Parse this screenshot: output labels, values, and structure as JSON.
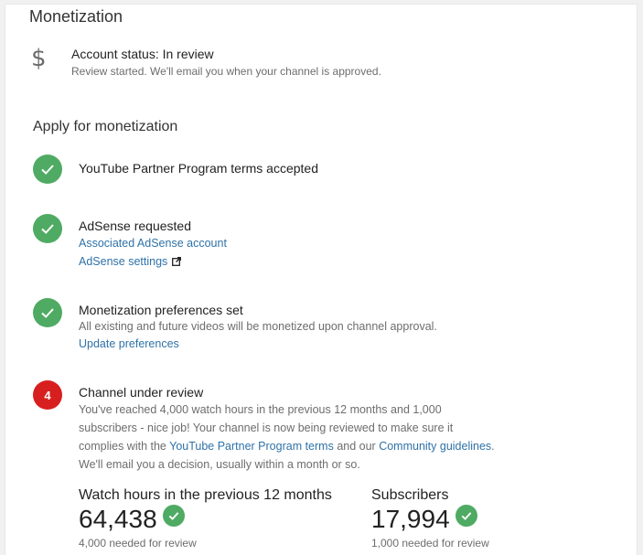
{
  "header": {
    "title": "Monetization"
  },
  "status": {
    "icon": "dollar-icon",
    "symbol": "$",
    "title": "Account status: In review",
    "description": "Review started. We'll email you when your channel is approved."
  },
  "apply": {
    "heading": "Apply for monetization",
    "steps": [
      {
        "title": "YouTube Partner Program terms accepted"
      },
      {
        "title": "AdSense requested",
        "links": [
          "Associated AdSense account",
          "AdSense settings"
        ]
      },
      {
        "title": "Monetization preferences set",
        "text": "All existing and future videos will be monetized upon channel approval.",
        "link": "Update preferences"
      },
      {
        "number": "4",
        "title": "Channel under review",
        "lines": {
          "line1": "You've reached 4,000 watch hours in the previous 12 months and 1,000",
          "line2": "subscribers - nice job! Your channel is now being reviewed to make sure it",
          "line3_pre": "complies with the ",
          "line3_link1": "YouTube Partner Program terms",
          "line3_mid": " and our ",
          "line3_link2": "Community guidelines",
          "line3_post": ".",
          "line4": "We'll email you a decision, usually within a month or so."
        }
      }
    ]
  },
  "stats": {
    "watch": {
      "label": "Watch hours in the previous 12 months",
      "value": "64,438",
      "note": "4,000 needed for review"
    },
    "subs": {
      "label": "Subscribers",
      "value": "17,994",
      "note": "1,000 needed for review"
    }
  },
  "colors": {
    "accent_green": "#4fab63",
    "alert_red": "#d81f1f",
    "link_blue": "#2f72a8"
  }
}
